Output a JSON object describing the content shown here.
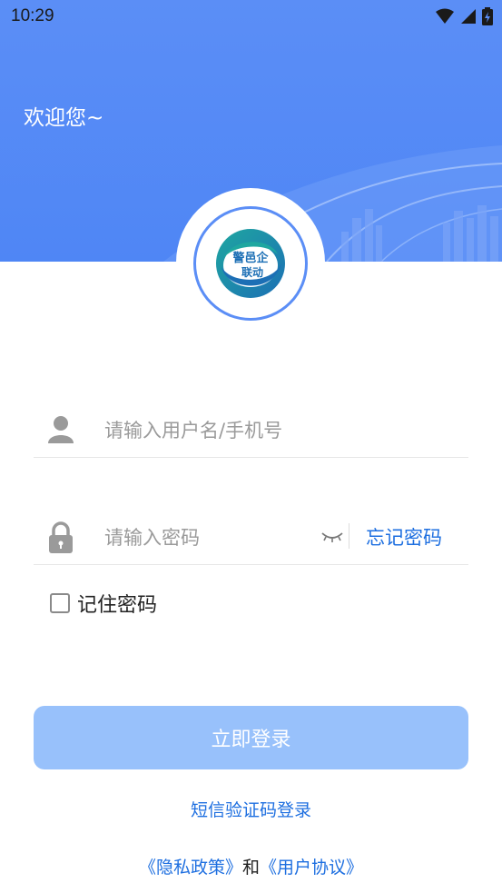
{
  "status_bar": {
    "time": "10:29"
  },
  "header": {
    "welcome_text": "欢迎您~"
  },
  "logo": {
    "text_top": "警邑企",
    "text_bottom": "联动"
  },
  "username": {
    "placeholder": "请输入用户名/手机号",
    "value": ""
  },
  "password": {
    "placeholder": "请输入密码",
    "value": "",
    "forgot_label": "忘记密码"
  },
  "remember": {
    "label": "记住密码",
    "checked": false
  },
  "login_button": {
    "label": "立即登录"
  },
  "sms_login": {
    "label": "短信验证码登录"
  },
  "agreements": {
    "privacy_label": "《隐私政策》",
    "connector": "和",
    "user_agreement_label": "《用户协议》"
  },
  "colors": {
    "primary": "#5b8ef6",
    "link": "#1e6fe0",
    "button_disabled": "#98c1fb"
  },
  "icons": [
    "wifi-icon",
    "signal-icon",
    "battery-icon",
    "user-icon",
    "lock-icon",
    "eye-closed-icon"
  ]
}
